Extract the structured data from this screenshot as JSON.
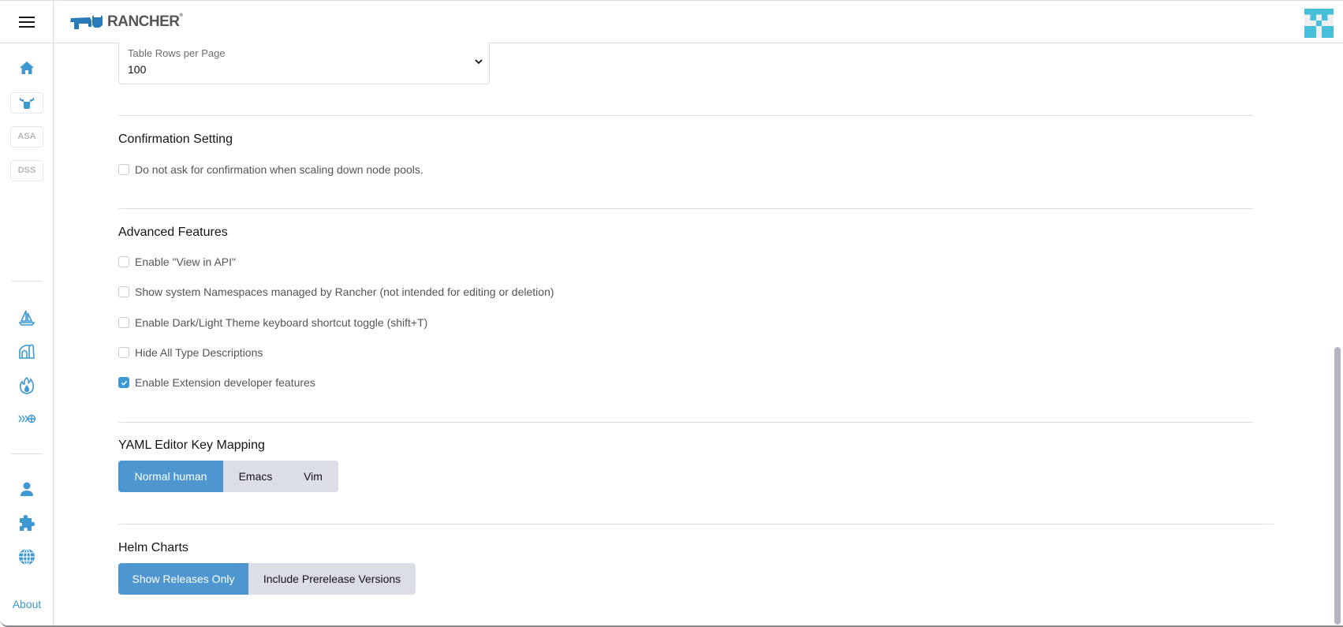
{
  "header": {
    "menu_icon": "hamburger-menu-icon",
    "brand": "RANCHER",
    "brand_mark": "®",
    "avatar_icon": "user-avatar-identicon"
  },
  "sidenav": {
    "items": [
      {
        "name": "home",
        "icon": "home-icon"
      },
      {
        "name": "local-cluster",
        "icon": "rancher-cow-icon"
      },
      {
        "name": "cluster-asa",
        "label": "ASA"
      },
      {
        "name": "cluster-dss",
        "label": "DSS"
      },
      {
        "name": "continuous-delivery",
        "icon": "sailboat-icon"
      },
      {
        "name": "cluster-management",
        "icon": "barn-icon"
      },
      {
        "name": "virtualization",
        "icon": "flame-icon"
      },
      {
        "name": "longhorn",
        "icon": "braid-icon"
      },
      {
        "name": "users-auth",
        "icon": "user-icon"
      },
      {
        "name": "extensions",
        "icon": "puzzle-icon"
      },
      {
        "name": "global-settings",
        "icon": "globe-icon"
      }
    ],
    "about_label": "About"
  },
  "settings": {
    "table_rows": {
      "label": "Table Rows per Page",
      "value": "100"
    },
    "confirmation": {
      "title": "Confirmation Setting",
      "options": [
        {
          "label": "Do not ask for confirmation when scaling down node pools.",
          "checked": false
        }
      ]
    },
    "advanced": {
      "title": "Advanced Features",
      "options": [
        {
          "label": "Enable \"View in API\"",
          "checked": false
        },
        {
          "label": "Show system Namespaces managed by Rancher (not intended for editing or deletion)",
          "checked": false
        },
        {
          "label": "Enable Dark/Light Theme keyboard shortcut toggle (shift+T)",
          "checked": false
        },
        {
          "label": "Hide All Type Descriptions",
          "checked": false
        },
        {
          "label": "Enable Extension developer features",
          "checked": true
        }
      ]
    },
    "yaml_keymap": {
      "title": "YAML Editor Key Mapping",
      "options": [
        "Normal human",
        "Emacs",
        "Vim"
      ],
      "selected": "Normal human"
    },
    "helm_charts": {
      "title": "Helm Charts",
      "options": [
        "Show Releases Only",
        "Include Prerelease Versions"
      ],
      "selected": "Show Releases Only"
    }
  },
  "colors": {
    "accent": "#3d98d3",
    "active_button": "#4d96cf",
    "inactive_button": "#dcdee7",
    "border": "#dcdee7",
    "brand_blue": "#2a7ab8",
    "avatar_teal": "#46bfd8"
  }
}
